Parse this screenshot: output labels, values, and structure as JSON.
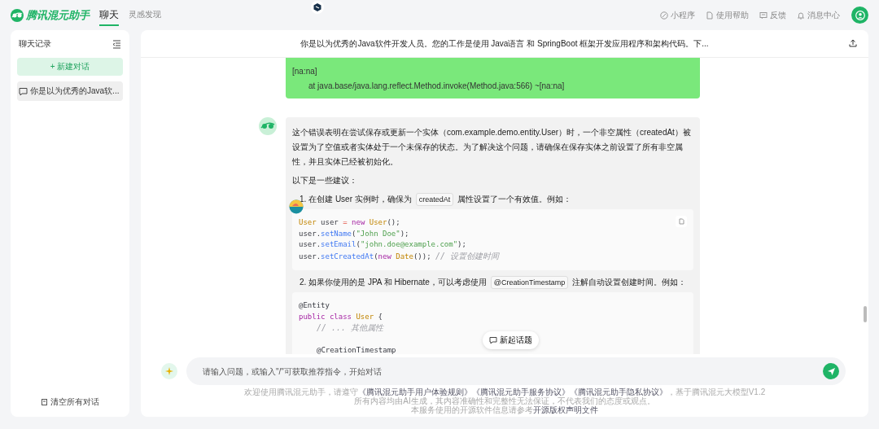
{
  "app": {
    "logo": "腾讯混元助手",
    "nav": [
      {
        "label": "聊天",
        "selected": true
      },
      {
        "label": "灵感发现",
        "selected": false
      }
    ],
    "links": [
      {
        "label": "小程序",
        "kind": "miniapp"
      },
      {
        "label": "使用帮助",
        "kind": "doc"
      },
      {
        "label": "反馈",
        "kind": "feedback"
      },
      {
        "label": "消息中心",
        "kind": "bell"
      }
    ]
  },
  "sidebar": {
    "title": "聊天记录",
    "new_chat": "+ 新建对话",
    "items": [
      {
        "title": "你是以为优秀的Java软...",
        "selected": true
      }
    ],
    "clear": "清空所有对话"
  },
  "chat": {
    "title": "你是以为优秀的Java软件开发人员。您的工作是使用 Java语言 和 SpringBoot 框架开发应用程序和架构代码。下...",
    "messages": [
      {
        "kind": "user",
        "lines": [
          {
            "text": "[na:na]",
            "indent": false
          },
          {
            "text": "at java.base/java.lang.reflect.Method.invoke(Method.java:566) ~[na:na]",
            "indent": true
          }
        ]
      },
      {
        "kind": "assistant",
        "blocks": [
          {
            "kind": "paragraph",
            "text": "这个错误表明在尝试保存或更新一个实体（com.example.demo.entity.User）时，一个非空属性（createdAt）被设置为了空值或者实体处于一个未保存的状态。为了解决这个问题，请确保在保存实体之前设置了所有非空属性，并且实体已经被初始化。"
          },
          {
            "kind": "paragraph",
            "text": "以下是一些建议："
          },
          {
            "kind": "step",
            "parts": [
              {
                "text": "1. 在创建 User 实例时，确保为"
              },
              {
                "code": "createdAt"
              },
              {
                "text": "属性设置了一个有效值。例如："
              }
            ]
          },
          {
            "kind": "code",
            "copy": true,
            "lines": [
              {
                "tokens": [
                  {
                    "text": "User",
                    "kind": "type"
                  },
                  {
                    "text": " user ",
                    "kind": "plain"
                  },
                  {
                    "text": "=",
                    "kind": "op"
                  },
                  {
                    "text": " new ",
                    "kind": "kw"
                  },
                  {
                    "text": "User",
                    "kind": "type"
                  },
                  {
                    "text": "();",
                    "kind": "plain"
                  }
                ]
              },
              {
                "tokens": [
                  {
                    "text": "user.",
                    "kind": "plain"
                  },
                  {
                    "text": "setName",
                    "kind": "fn"
                  },
                  {
                    "text": "(",
                    "kind": "plain"
                  },
                  {
                    "text": "\"John Doe\"",
                    "kind": "str"
                  },
                  {
                    "text": ");",
                    "kind": "plain"
                  }
                ]
              },
              {
                "tokens": [
                  {
                    "text": "user.",
                    "kind": "plain"
                  },
                  {
                    "text": "setEmail",
                    "kind": "fn"
                  },
                  {
                    "text": "(",
                    "kind": "plain"
                  },
                  {
                    "text": "\"john.doe@example.com\"",
                    "kind": "str"
                  },
                  {
                    "text": ");",
                    "kind": "plain"
                  }
                ]
              },
              {
                "tokens": [
                  {
                    "text": "user.",
                    "kind": "plain"
                  },
                  {
                    "text": "setCreatedAt",
                    "kind": "fn"
                  },
                  {
                    "text": "(",
                    "kind": "plain"
                  },
                  {
                    "text": "new ",
                    "kind": "kw"
                  },
                  {
                    "text": "Date",
                    "kind": "type"
                  },
                  {
                    "text": "()); ",
                    "kind": "plain"
                  },
                  {
                    "text": "// 设置创建时间",
                    "kind": "com"
                  }
                ]
              }
            ]
          },
          {
            "kind": "step",
            "parts": [
              {
                "text": "2. 如果你使用的是 JPA 和 Hibernate，可以考虑使用"
              },
              {
                "code": "@CreationTimestamp"
              },
              {
                "text": "注解自动设置创建时间。例如："
              }
            ]
          },
          {
            "kind": "code",
            "lines": [
              {
                "tokens": [
                  {
                    "text": "@Entity",
                    "kind": "plain"
                  }
                ]
              },
              {
                "tokens": [
                  {
                    "text": "public class ",
                    "kind": "kw"
                  },
                  {
                    "text": "User",
                    "kind": "type"
                  },
                  {
                    "text": " {",
                    "kind": "plain"
                  }
                ]
              },
              {
                "indent": true,
                "tokens": [
                  {
                    "text": "// ... 其他属性",
                    "kind": "com"
                  }
                ]
              },
              {
                "indent": true,
                "gap_before": true,
                "tokens": [
                  {
                    "text": "@CreationTimestamp",
                    "kind": "plain"
                  }
                ]
              }
            ]
          }
        ]
      }
    ],
    "new_topic": "新起话题",
    "input": {
      "placeholder": "请输入问题，或输入\"/\"可获取推荐指令，开始对话"
    },
    "footer": [
      [
        {
          "text": "欢迎使用腾讯混元助手，请遵守"
        },
        {
          "link": "《腾讯混元助手用户体验规则》"
        },
        {
          "link": "《腾讯混元助手服务协议》"
        },
        {
          "link": "《腾讯混元助手隐私协议》"
        },
        {
          "text": "，基于腾讯混元大模型V1.2"
        }
      ],
      [
        {
          "text": "所有内容均由AI生成，其内容准确性和完整性无法保证，不代表我们的态度或观点。"
        }
      ],
      [
        {
          "text": "本服务使用的开源软件信息请参考"
        },
        {
          "link": "开源版权声明文件"
        }
      ]
    ]
  }
}
